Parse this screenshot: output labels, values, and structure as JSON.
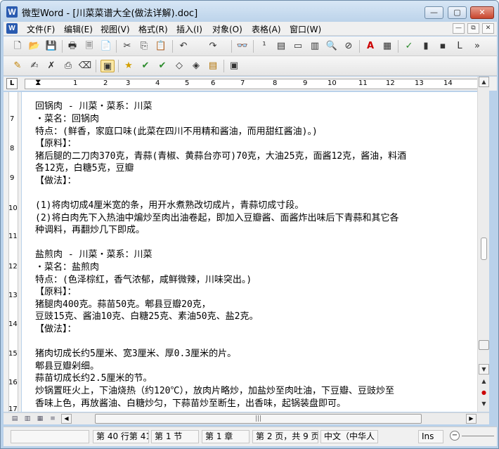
{
  "window": {
    "title": "微型Word - [川菜菜谱大全(做法详解).doc]",
    "app_icon": "W",
    "controls": {
      "minimize": "—",
      "maximize": "▢",
      "close": "✕"
    }
  },
  "menu": {
    "icon": "W",
    "items": [
      "文件(F)",
      "编辑(E)",
      "视图(V)",
      "格式(R)",
      "插入(I)",
      "对象(O)",
      "表格(A)",
      "窗口(W)"
    ],
    "mdi": {
      "minimize": "—",
      "restore": "⧉",
      "close": "✕"
    }
  },
  "toolbar1": {
    "icons": [
      "new-document-icon",
      "open-folder-icon",
      "save-icon",
      "print-icon",
      "print-preview-icon",
      "pdf-icon",
      "cut-icon",
      "copy-icon",
      "paste-icon",
      "undo-icon",
      "redo-icon",
      "find-icon",
      "word-count-icon",
      "columns-icon",
      "page-icon",
      "frame-icon",
      "zoom-icon",
      "no-icon",
      "font-color-icon",
      "form-icon",
      "spellcheck-icon",
      "chart-icon",
      "table-icon",
      "layout-icon",
      "more-icon"
    ],
    "glyphs": [
      "🗋",
      "📂",
      "💾",
      "🖶",
      "🗏",
      "📄",
      "✂",
      "⎘",
      "📋",
      "↶",
      "↷",
      "👓",
      "¹",
      "▤",
      "▭",
      "▥",
      "🔍",
      "⊘",
      "A",
      "▦",
      "✓",
      "▮",
      "▪",
      "L",
      "»"
    ]
  },
  "toolbar2": {
    "icons": [
      "highlight-icon",
      "edit-icon",
      "delete-icon",
      "copy-format-icon",
      "clear-icon",
      "paste-special-icon",
      "star-icon",
      "check-icon",
      "check2-icon",
      "tag-icon",
      "tag2-icon",
      "note-icon",
      "clipboard-icon"
    ],
    "glyphs": [
      "✎",
      "✍",
      "✗",
      "⎙",
      "⌫",
      "▣",
      "★",
      "✔",
      "✔",
      "◇",
      "◈",
      "▤",
      "▣"
    ]
  },
  "ruler": {
    "tab_selector": "L",
    "numbers": [
      "1",
      "2",
      "3",
      "4",
      "5",
      "6",
      "7",
      "8",
      "9",
      "10",
      "11",
      "12",
      "13",
      "14"
    ],
    "indent_marker": "⧗"
  },
  "vruler": {
    "numbers": [
      "7",
      "8",
      "9",
      "10",
      "11",
      "12",
      "13",
      "14",
      "15",
      "16",
      "17"
    ]
  },
  "document": {
    "lines": [
      "回锅肉 - 川菜・菜系：川菜",
      "・菜名：回锅肉",
      "   特点：(鲜香，家庭口味(此菜在四川不用精和酱油，而用甜红酱油)。)",
      "【原料】：",
      "猪后腿的二刀肉370克，青蒜(青椒、黄蒜台亦可)70克，大油25克，面酱12克，酱油，料酒",
      "各12克，白糖5克，豆瓣",
      "【做法】：",
      "",
      "(1)将肉切成4厘米宽的条，用开水煮熟改切成片，青蒜切成寸段。",
      "(2)将白肉先下入热油中煸炒至肉出油卷起，即加入豆瓣酱、面酱炸出味后下青蒜和其它各",
      "种调料，再翻炒几下即成。",
      "",
      "盐煎肉 - 川菜・菜系：川菜",
      "・菜名：盐煎肉",
      "   特点：(色泽棕红，香气浓郁，咸鲜微辣，川味突出。)",
      "【原料】：",
      "猪腿肉400克。蒜苗50克。郫县豆瓣20克，",
      "豆豉15克、酱油10克、白糖25克、素油50克、盐2克。",
      "【做法】：",
      "",
      "猪肉切成长约5厘米、宽3厘米、厚0.3厘米的片。",
      "郫县豆瓣剁细。",
      "蒜苗切成长约2.5厘米的节。",
      "炒锅置旺火上，下油烧热（约120℃），放肉片略炒，加盐炒至肉吐油，下豆瓣、豆豉炒至",
      "香味上色，再放酱油、白糖炒匀，下蒜苗炒至断生，出香味，起锅装盘即可。"
    ]
  },
  "vscroll": {
    "up": "▲",
    "down": "▼",
    "prev_page": "▲",
    "select_browse": "●",
    "next_page": "▼"
  },
  "hscroll": {
    "left": "◀",
    "right": "▶",
    "thumb_grip": "|||"
  },
  "status": {
    "position": "第 40 行第 41",
    "section": "第 1 节",
    "chapter": "第 1 章",
    "page": "第 2 页，共 9 页",
    "language": "中文（中华人",
    "mode": "Ins",
    "zoom_out": "−"
  }
}
